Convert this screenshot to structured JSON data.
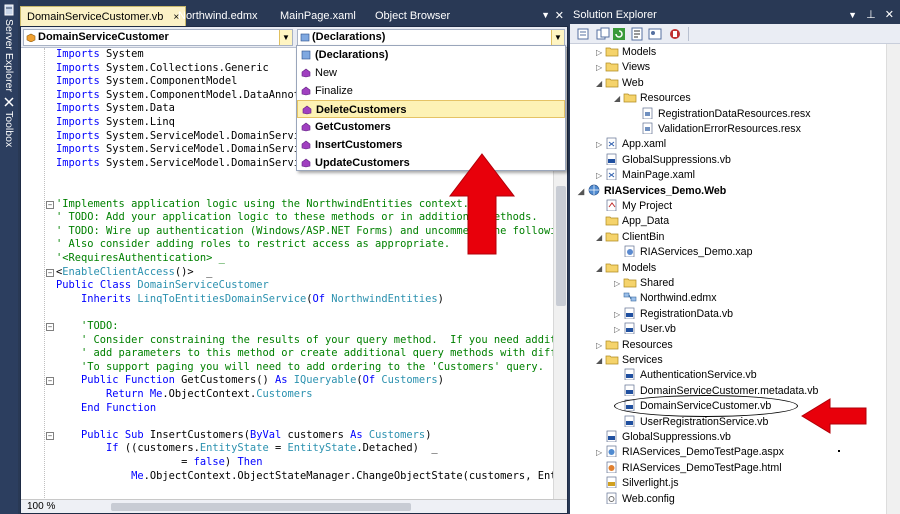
{
  "side_tabs": [
    "Server Explorer",
    "Toolbox"
  ],
  "editor": {
    "tabs": [
      "DomainServiceCustomer.vb",
      "Northwind.edmx",
      "MainPage.xaml",
      "Object Browser"
    ],
    "tab_close": "×",
    "left_combo": "DomainServiceCustomer",
    "right_combo": "(Declarations)",
    "zoom": "100 %"
  },
  "dropdown": {
    "items": [
      "(Declarations)",
      "New",
      "Finalize",
      "DeleteCustomers",
      "GetCustomers",
      "InsertCustomers",
      "UpdateCustomers"
    ],
    "selected": "DeleteCustomers"
  },
  "code_lines": [
    "Imports System",
    "Imports System.Collections.Generic",
    "Imports System.ComponentModel",
    "Imports System.ComponentModel.DataAnnota",
    "Imports System.Data",
    "Imports System.Linq",
    "Imports System.ServiceModel.DomainServic",
    "Imports System.ServiceModel.DomainServic",
    "Imports System.ServiceModel.DomainServic",
    "",
    "",
    "'Implements application logic using the NorthwindEntities context.",
    "' TODO: Add your application logic to these methods or in additional methods.",
    "' TODO: Wire up authentication (Windows/ASP.NET Forms) and uncomment the following t",
    "' Also consider adding roles to restrict access as appropriate.",
    "'<RequiresAuthentication> _",
    "<EnableClientAccess()>  _",
    "Public Class DomainServiceCustomer",
    "    Inherits LinqToEntitiesDomainService(Of NorthwindEntities)",
    "",
    "    'TODO:",
    "    ' Consider constraining the results of your query method.  If you need additiona",
    "    ' add parameters to this method or create additional query methods with differen",
    "    'To support paging you will need to add ordering to the 'Customers' query.",
    "    Public Function GetCustomers() As IQueryable(Of Customers)",
    "        Return Me.ObjectContext.Customers",
    "    End Function",
    "",
    "    Public Sub InsertCustomers(ByVal customers As Customers)",
    "        If ((customers.EntityState = EntityState.Detached)  _",
    "                    = false) Then",
    "            Me.ObjectContext.ObjectStateManager.ChangeObjectState(customers, EntitySt"
  ],
  "solution_explorer": {
    "title": "Solution Explorer",
    "nodes": [
      {
        "label": "Models",
        "icon": "folder-icon"
      },
      {
        "label": "Views",
        "icon": "folder-icon"
      },
      {
        "label": "Web",
        "icon": "folder-icon"
      },
      {
        "label": "Resources",
        "icon": "folder-icon"
      },
      {
        "label": "RegistrationDataResources.resx",
        "icon": "resx-file-icon"
      },
      {
        "label": "ValidationErrorResources.resx",
        "icon": "resx-file-icon"
      },
      {
        "label": "App.xaml",
        "icon": "xaml-file-icon"
      },
      {
        "label": "GlobalSuppressions.vb",
        "icon": "vb-file-icon"
      },
      {
        "label": "MainPage.xaml",
        "icon": "xaml-file-icon"
      },
      {
        "label": "RIAServices_Demo.Web",
        "icon": "web-project-icon"
      },
      {
        "label": "My Project",
        "icon": "my-project-icon"
      },
      {
        "label": "App_Data",
        "icon": "folder-icon"
      },
      {
        "label": "ClientBin",
        "icon": "folder-icon"
      },
      {
        "label": "RIAServices_Demo.xap",
        "icon": "xap-file-icon"
      },
      {
        "label": "Models",
        "icon": "folder-icon"
      },
      {
        "label": "Shared",
        "icon": "folder-icon"
      },
      {
        "label": "Northwind.edmx",
        "icon": "edmx-file-icon"
      },
      {
        "label": "RegistrationData.vb",
        "icon": "vb-file-icon"
      },
      {
        "label": "User.vb",
        "icon": "vb-file-icon"
      },
      {
        "label": "Resources",
        "icon": "folder-icon"
      },
      {
        "label": "Services",
        "icon": "folder-icon"
      },
      {
        "label": "AuthenticationService.vb",
        "icon": "vb-file-icon"
      },
      {
        "label": "DomainServiceCustomer.metadata.vb",
        "icon": "vb-file-icon"
      },
      {
        "label": "DomainServiceCustomer.vb",
        "icon": "vb-file-icon"
      },
      {
        "label": "UserRegistrationService.vb",
        "icon": "vb-file-icon"
      },
      {
        "label": "GlobalSuppressions.vb",
        "icon": "vb-file-icon"
      },
      {
        "label": "RIAServices_DemoTestPage.aspx",
        "icon": "aspx-file-icon"
      },
      {
        "label": "RIAServices_DemoTestPage.html",
        "icon": "html-file-icon"
      },
      {
        "label": "Silverlight.js",
        "icon": "js-file-icon"
      },
      {
        "label": "Web.config",
        "icon": "config-file-icon"
      }
    ]
  },
  "colors": {
    "ide_background": "#293955",
    "keyword": "#0000ff",
    "type": "#2b91af",
    "comment": "#008000",
    "arrow": "#e8000b",
    "selection": "#fdf2b5"
  }
}
